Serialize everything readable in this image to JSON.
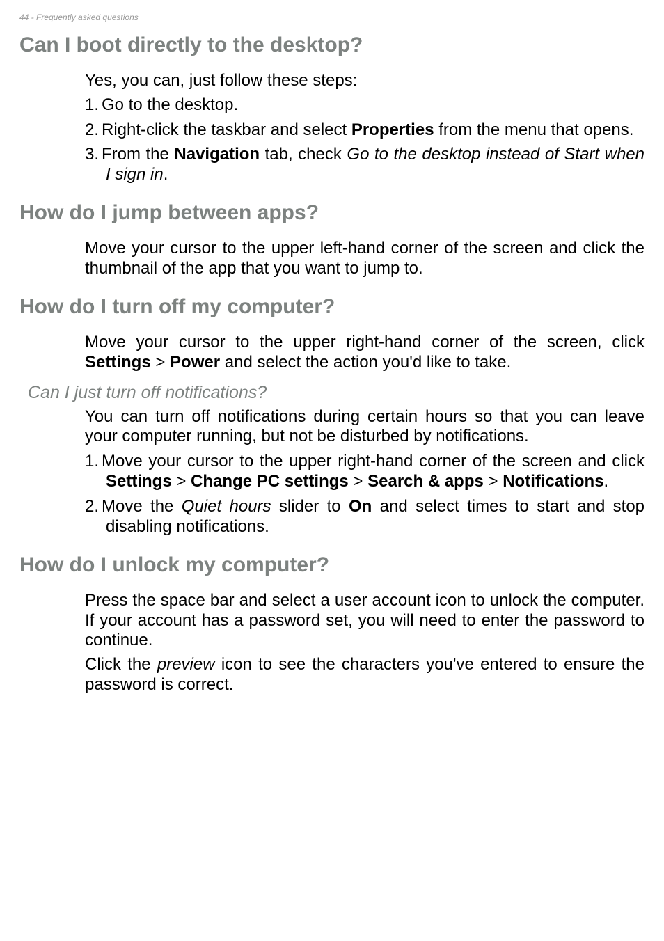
{
  "header": "44 - Frequently asked questions",
  "sections": [
    {
      "heading": "Can I boot directly to the desktop?",
      "intro": "Yes, you can, just follow these steps:",
      "list": [
        [
          {
            "t": "Go to the desktop."
          }
        ],
        [
          {
            "t": "Right-click the taskbar and select "
          },
          {
            "b": "Properties"
          },
          {
            "t": " from the menu that opens."
          }
        ],
        [
          {
            "t": "From the "
          },
          {
            "b": "Navigation"
          },
          {
            "t": " tab, check "
          },
          {
            "i": "Go to the desktop instead of Start when I sign in"
          },
          {
            "t": "."
          }
        ]
      ]
    },
    {
      "heading": "How do I jump between apps?",
      "paras": [
        [
          {
            "t": "Move your cursor to the upper left-hand corner of the screen and click the thumbnail of the app that you want to jump to."
          }
        ]
      ]
    },
    {
      "heading": "How do I turn off my computer?",
      "paras": [
        [
          {
            "t": "Move your cursor to the upper right-hand corner of the screen, click "
          },
          {
            "b": "Settings"
          },
          {
            "t": " > "
          },
          {
            "b": "Power"
          },
          {
            "t": " and select the action you'd like to take."
          }
        ]
      ],
      "sub": {
        "heading": "Can I just turn off notifications?",
        "paras": [
          [
            {
              "t": "You can turn off notifications during certain hours so that you can leave your computer running, but not be disturbed by notifications."
            }
          ]
        ],
        "list": [
          [
            {
              "t": "Move your cursor to the upper right-hand corner of the screen and click "
            },
            {
              "b": "Settings"
            },
            {
              "t": " > "
            },
            {
              "b": "Change PC settings"
            },
            {
              "t": " > "
            },
            {
              "b": "Search & apps"
            },
            {
              "t": " > "
            },
            {
              "b": "Notifications"
            },
            {
              "t": "."
            }
          ],
          [
            {
              "t": "Move the "
            },
            {
              "i": "Quiet hours"
            },
            {
              "t": " slider to "
            },
            {
              "b": "On"
            },
            {
              "t": " and select times to start and stop disabling notifications."
            }
          ]
        ]
      }
    },
    {
      "heading": "How do I unlock my computer?",
      "paras": [
        [
          {
            "t": "Press the space bar and select a user account icon to unlock the computer. If your account has a password set, you will need to enter the password to continue."
          }
        ],
        [
          {
            "t": "Click the "
          },
          {
            "i": "preview"
          },
          {
            "t": " icon to see the characters you've entered to ensure the password is correct."
          }
        ]
      ]
    }
  ]
}
